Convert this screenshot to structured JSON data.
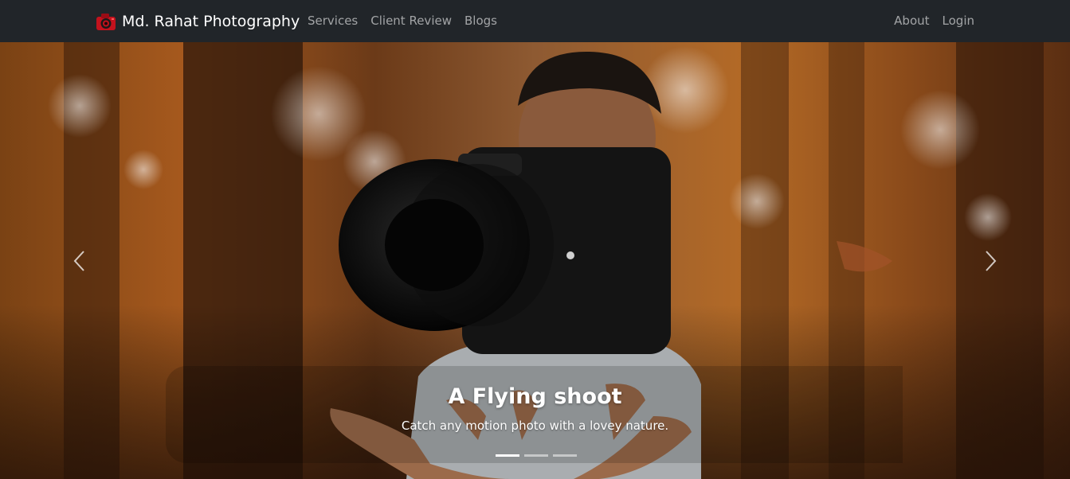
{
  "navbar": {
    "brand": "Md. Rahat Photography",
    "brand_logo_icon": "camera-logo-icon",
    "left_links": [
      "Services",
      "Client Review",
      "Blogs"
    ],
    "right_links": [
      "About",
      "Login"
    ],
    "background": "#212529"
  },
  "carousel": {
    "slide": {
      "title": "A Flying shoot",
      "caption": "Catch any motion photo with a lovey nature."
    },
    "prev_icon": "chevron-left-icon",
    "next_icon": "chevron-right-icon",
    "indicator_count": 3,
    "active_indicator": 0
  }
}
